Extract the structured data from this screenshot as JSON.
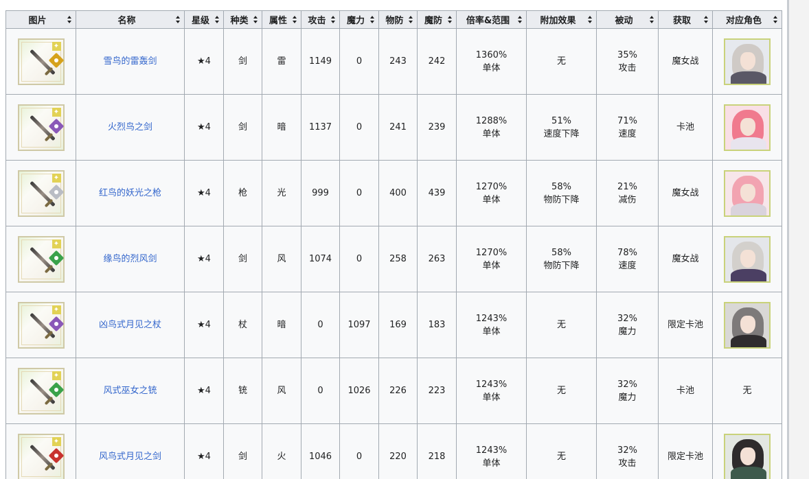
{
  "table": {
    "headers": [
      "图片",
      "名称",
      "星级",
      "种类",
      "属性",
      "攻击",
      "魔力",
      "物防",
      "魔防",
      "倍率&范围",
      "附加效果",
      "被动",
      "获取",
      "对应角色"
    ],
    "rows": [
      {
        "name": "雪鸟的雷轰剑",
        "star": "★4",
        "kind": "剑",
        "attr": "雷",
        "atk": "1149",
        "mag": "0",
        "pdef": "243",
        "mdef": "242",
        "rate": "1360%",
        "range": "单体",
        "effect_value": "无",
        "effect_desc": "",
        "passive_value": "35%",
        "passive_desc": "攻击",
        "obtain": "魔女战",
        "character": "portrait",
        "gem_color": "#d6a21b",
        "gem_icon": "lightning-gem-icon",
        "char_hair": "#cfcac6",
        "char_bg": "#e6e9ee",
        "char_body": "#5a5866"
      },
      {
        "name": "火烈鸟之剑",
        "star": "★4",
        "kind": "剑",
        "attr": "暗",
        "atk": "1137",
        "mag": "0",
        "pdef": "241",
        "mdef": "239",
        "rate": "1288%",
        "range": "单体",
        "effect_value": "51%",
        "effect_desc": "速度下降",
        "passive_value": "71%",
        "passive_desc": "速度",
        "obtain": "卡池",
        "character": "portrait",
        "gem_color": "#8a58b8",
        "gem_icon": "dark-gem-icon",
        "char_hair": "#f07a8e",
        "char_bg": "#f9dfe6",
        "char_body": "#e8e4ee"
      },
      {
        "name": "红鸟的妖光之枪",
        "star": "★4",
        "kind": "枪",
        "attr": "光",
        "atk": "999",
        "mag": "0",
        "pdef": "400",
        "mdef": "439",
        "rate": "1270%",
        "range": "单体",
        "effect_value": "58%",
        "effect_desc": "物防下降",
        "passive_value": "21%",
        "passive_desc": "减伤",
        "obtain": "魔女战",
        "character": "portrait",
        "gem_color": "#b9bcc4",
        "gem_icon": "light-gem-icon",
        "char_hair": "#f2a3b1",
        "char_bg": "#f7e6ea",
        "char_body": "#d9d3dc"
      },
      {
        "name": "缘鸟的烈风剑",
        "star": "★4",
        "kind": "剑",
        "attr": "风",
        "atk": "1074",
        "mag": "0",
        "pdef": "258",
        "mdef": "263",
        "rate": "1270%",
        "range": "单体",
        "effect_value": "58%",
        "effect_desc": "物防下降",
        "passive_value": "78%",
        "passive_desc": "速度",
        "obtain": "魔女战",
        "character": "portrait",
        "gem_color": "#3aa24a",
        "gem_icon": "wind-gem-icon",
        "char_hair": "#d3d0cc",
        "char_bg": "#e4e6ea",
        "char_body": "#4b3f63"
      },
      {
        "name": "凶鸟式月见之杖",
        "star": "★4",
        "kind": "杖",
        "attr": "暗",
        "atk": "0",
        "mag": "1097",
        "pdef": "169",
        "mdef": "183",
        "rate": "1243%",
        "range": "单体",
        "effect_value": "无",
        "effect_desc": "",
        "passive_value": "32%",
        "passive_desc": "魔力",
        "obtain": "限定卡池",
        "character": "portrait",
        "gem_color": "#8a58b8",
        "gem_icon": "dark-gem-icon",
        "char_hair": "#7d7a7a",
        "char_bg": "#d9d8d6",
        "char_body": "#2f2c2e"
      },
      {
        "name": "风式巫女之铳",
        "star": "★4",
        "kind": "铳",
        "attr": "风",
        "atk": "0",
        "mag": "1026",
        "pdef": "226",
        "mdef": "223",
        "rate": "1243%",
        "range": "单体",
        "effect_value": "无",
        "effect_desc": "",
        "passive_value": "32%",
        "passive_desc": "魔力",
        "obtain": "卡池",
        "character": "无",
        "gem_color": "#3aa24a",
        "gem_icon": "wind-gem-icon",
        "char_hair": "",
        "char_bg": "",
        "char_body": ""
      },
      {
        "name": "风鸟式月见之剑",
        "star": "★4",
        "kind": "剑",
        "attr": "火",
        "atk": "1046",
        "mag": "0",
        "pdef": "220",
        "mdef": "218",
        "rate": "1243%",
        "range": "单体",
        "effect_value": "无",
        "effect_desc": "",
        "passive_value": "32%",
        "passive_desc": "攻击",
        "obtain": "限定卡池",
        "character": "portrait",
        "gem_color": "#c8322e",
        "gem_icon": "fire-gem-icon",
        "char_hair": "#2e2b2c",
        "char_bg": "#e3e7e2",
        "char_body": "#3e5a4c"
      }
    ]
  },
  "colors": {
    "header_bg": "#eaecf0",
    "cell_bg": "#f8f9fa",
    "border": "#a2a9b1",
    "link": "#3366cc"
  }
}
